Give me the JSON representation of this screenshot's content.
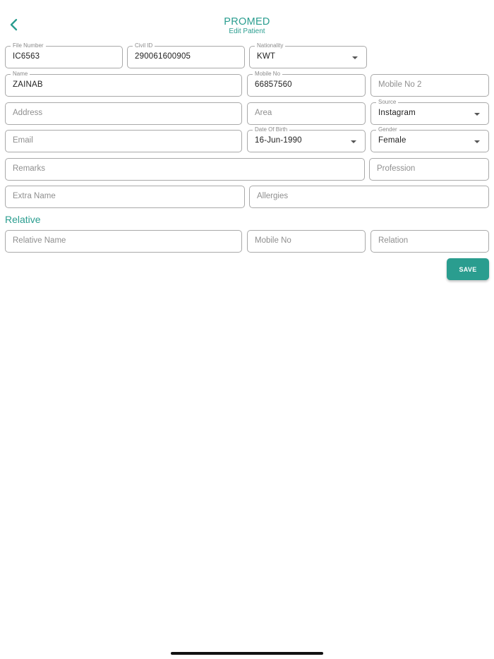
{
  "header": {
    "title": "PROMED",
    "subtitle": "Edit Patient",
    "back_icon": "chevron-left-icon"
  },
  "form": {
    "file_number": {
      "label": "File Number",
      "value": "IC6563"
    },
    "civil_id": {
      "label": "Civil ID",
      "value": "290061600905"
    },
    "nationality": {
      "label": "Nationality",
      "value": "KWT"
    },
    "name": {
      "label": "Name",
      "value": "ZAINAB"
    },
    "mobile_no": {
      "label": "Mobile No",
      "value": "66857560"
    },
    "mobile_no_2": {
      "placeholder": "Mobile No 2"
    },
    "address": {
      "placeholder": "Address"
    },
    "area": {
      "placeholder": "Area"
    },
    "source": {
      "label": "Source",
      "value": "Instagram"
    },
    "email": {
      "placeholder": "Email"
    },
    "date_of_birth": {
      "label": "Date Of Birth",
      "value": "16-Jun-1990"
    },
    "gender": {
      "label": "Gender",
      "value": "Female"
    },
    "remarks": {
      "placeholder": "Remarks"
    },
    "profession": {
      "placeholder": "Profession"
    },
    "extra_name": {
      "placeholder": "Extra Name"
    },
    "allergies": {
      "placeholder": "Allergies"
    }
  },
  "relative": {
    "section_title": "Relative",
    "relative_name": {
      "placeholder": "Relative Name"
    },
    "mobile_no": {
      "placeholder": "Mobile No"
    },
    "relation": {
      "placeholder": "Relation"
    }
  },
  "actions": {
    "save_label": "SAVE"
  },
  "colors": {
    "accent": "#2a9d8f",
    "border": "#a9a9a9"
  }
}
